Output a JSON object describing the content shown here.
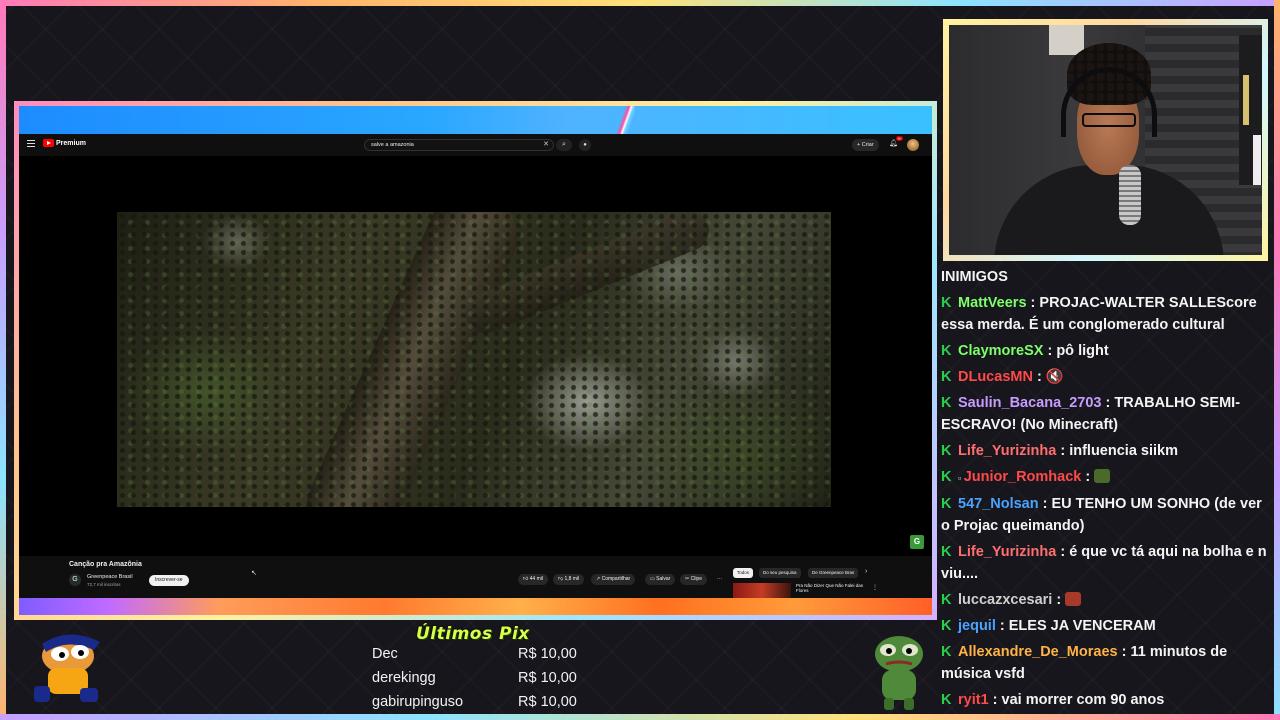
{
  "youtube": {
    "logo_text": "Premium",
    "search_query": "salve a amazonia",
    "create_label": "Criar",
    "notification_count": "9+",
    "video_title": "Canção pra Amazônia",
    "channel_name": "Greenpeace Brasil",
    "channel_subs": "72,7 mil inscritos",
    "subscribe_label": "Inscrever-se",
    "like_label": "44 mil",
    "dislike_label": "1,8 mil",
    "share_label": "Compartilhar",
    "save_label": "Salvar",
    "clip_label": "Clipe",
    "more_label": "···",
    "chips": [
      "Todos",
      "Do seu pesquisa",
      "De Greenpeace Bras"
    ],
    "rec_title": "Pra Não Dizer Que Não Falei das Flores"
  },
  "chat": {
    "messages": [
      {
        "user": "",
        "color": "#f4f4f4",
        "text": "INIMIGOS",
        "badge": false
      },
      {
        "user": "MattVeers",
        "color": "#7dff6a",
        "text": "PROJAC-WALTER SALLEScore essa merda. É um conglomerado cultural",
        "badge": true
      },
      {
        "user": "ClaymoreSX",
        "color": "#7dff6a",
        "text": "pô light",
        "badge": true
      },
      {
        "user": "DLucasMN",
        "color": "#ff4a4a",
        "text": "🔇",
        "badge": true
      },
      {
        "user": "Saulin_Bacana_2703",
        "color": "#c79cff",
        "text": "TRABALHO SEMI-ESCRAVO! (No Minecraft)",
        "badge": true
      },
      {
        "user": "Life_Yurizinha",
        "color": "#ff6f6f",
        "text": "influencia siikm",
        "badge": true
      },
      {
        "user": "Junior_Romhack",
        "color": "#ff4a4a",
        "text": "",
        "badge": true,
        "emote": "#4a6a2a",
        "extra_badge": true
      },
      {
        "user": "547_Nolsan",
        "color": "#4aa3ff",
        "text": "EU TENHO UM SONHO (de ver o Projac queimando)",
        "badge": true
      },
      {
        "user": "Life_Yurizinha",
        "color": "#ff6f6f",
        "text": "é que vc tá aqui na bolha e n viu....",
        "badge": true
      },
      {
        "user": "luccazxcesari",
        "color": "#cfcfcf",
        "text": "",
        "badge": true,
        "emote": "#a83a2a"
      },
      {
        "user": "jequil",
        "color": "#4aa3ff",
        "text": "ELES JA VENCERAM",
        "badge": true
      },
      {
        "user": "Allexandre_De_Moraes",
        "color": "#ffb347",
        "text": "11 minutos de música vsfd",
        "badge": true
      },
      {
        "user": "ryit1",
        "color": "#ff4a4a",
        "text": "vai morrer com 90 anos",
        "badge": true
      }
    ]
  },
  "pix": {
    "title": "Últimos Pix",
    "donations": [
      {
        "name": "Dec",
        "amount": "R$ 10,00"
      },
      {
        "name": "derekingg",
        "amount": "R$ 10,00"
      },
      {
        "name": "gabirupinguso",
        "amount": "R$ 10,00"
      }
    ]
  }
}
